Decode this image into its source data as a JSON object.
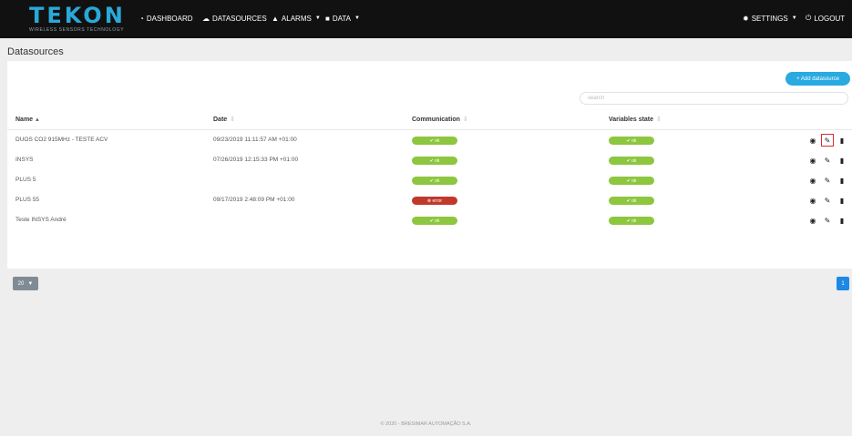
{
  "brand": {
    "name": "TEKON",
    "tagline": "WIRELESS SENSORS TECHNOLOGY"
  },
  "nav": {
    "dashboard": "DASHBOARD",
    "datasources": "DATASOURCES",
    "alarms": "ALARMS",
    "data": "DATA",
    "settings": "SETTINGS",
    "logout": "LOGOUT"
  },
  "page": {
    "title": "Datasources",
    "add_button": "+ Add datasource",
    "search_placeholder": "search"
  },
  "table": {
    "columns": {
      "name": "Name",
      "date": "Date",
      "communication": "Communication",
      "variables_state": "Variables state"
    },
    "rows": [
      {
        "name": "DUOS CO2 915MHz - TESTE ACV",
        "date": "09/23/2019 11:11:57 AM +01:00",
        "communication": "✔ ok",
        "communication_status": "ok",
        "variables": "✔ ok",
        "variables_status": "ok"
      },
      {
        "name": "INSYS",
        "date": "07/26/2019 12:15:33 PM +01:00",
        "communication": "✔ ok",
        "communication_status": "ok",
        "variables": "✔ ok",
        "variables_status": "ok"
      },
      {
        "name": "PLUS 5",
        "date": "",
        "communication": "✔ ok",
        "communication_status": "ok",
        "variables": "✔ ok",
        "variables_status": "ok"
      },
      {
        "name": "PLUS 55",
        "date": "09/17/2019 2:48:09 PM +01:00",
        "communication": "⊗ error",
        "communication_status": "error",
        "variables": "✔ ok",
        "variables_status": "ok"
      },
      {
        "name": "Teste INSYS André",
        "date": "",
        "communication": "✔ ok",
        "communication_status": "ok",
        "variables": "✔ ok",
        "variables_status": "ok"
      }
    ]
  },
  "pagination": {
    "page_size": "20",
    "current_page": "1"
  },
  "footer": {
    "text": "© 2020 - BRESIMAR AUTOMAÇÃO S.A."
  },
  "colors": {
    "navbar": "#111111",
    "accent": "#29aae1",
    "ok": "#8dc63f",
    "error": "#c0392b",
    "highlight": "#d32f2f"
  },
  "icons": [
    "dashboard-icon",
    "database-icon",
    "bell-icon",
    "server-icon",
    "gear-icon",
    "power-icon",
    "eye-icon",
    "pencil-icon",
    "trash-icon"
  ]
}
